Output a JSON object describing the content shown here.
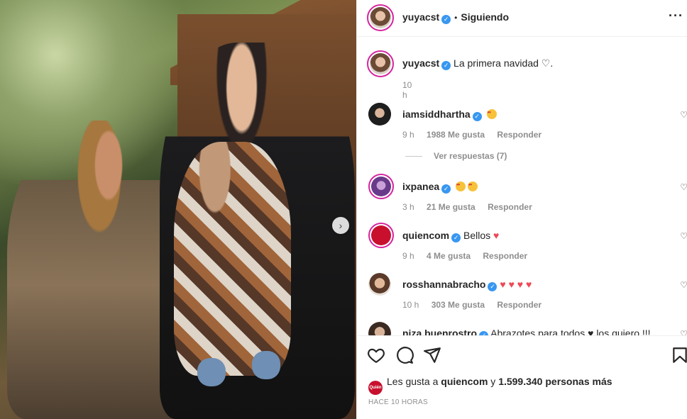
{
  "post": {
    "username": "yuyacst",
    "follow_status": "Siguiendo",
    "more_icon": "more-options-icon"
  },
  "caption": {
    "username": "yuyacst",
    "text": "La primera navidad",
    "time": "10 h"
  },
  "comments": [
    {
      "username": "iamsiddhartha",
      "verified": true,
      "text": "",
      "emoji_count": 1,
      "time": "9 h",
      "likes": "1988 Me gusta",
      "reply": "Responder"
    },
    {
      "username": "ixpanea",
      "verified": true,
      "text": "",
      "emoji_count": 2,
      "time": "3 h",
      "likes": "21 Me gusta",
      "reply": "Responder"
    },
    {
      "username": "quiencom",
      "verified": true,
      "text": "Bellos",
      "hearts": 1,
      "time": "9 h",
      "likes": "4 Me gusta",
      "reply": "Responder"
    },
    {
      "username": "rosshannabracho",
      "verified": true,
      "text": "",
      "hearts": 4,
      "time": "10 h",
      "likes": "303 Me gusta",
      "reply": "Responder"
    },
    {
      "username": "niza.buenrostro",
      "verified": true,
      "text": "Abrazotes para todos ♥ los quiero !!!",
      "time": "",
      "likes": "",
      "reply": ""
    }
  ],
  "view_replies": "Ver respuestas (7)",
  "likes_summary": {
    "prefix": "Les gusta a",
    "user": "quiencom",
    "joiner": "y",
    "rest": "1.599.340 personas más",
    "mini_avatar_text": "Quién"
  },
  "posted": "HACE 10 HORAS",
  "colors": {
    "verified": "#3897f0",
    "heart": "#ed4956",
    "muted": "#8e8e8e"
  }
}
